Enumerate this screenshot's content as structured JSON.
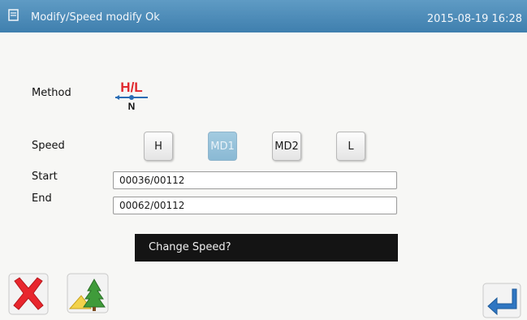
{
  "header": {
    "title": "Modify/Speed modify  Ok",
    "datetime": "2015-08-19 16:28"
  },
  "method": {
    "label": "Method",
    "icon_top_text": "H/L",
    "icon_bottom_text": "N"
  },
  "speed": {
    "label": "Speed",
    "options": [
      "H",
      "MD1",
      "MD2",
      "L"
    ],
    "selected": "MD1"
  },
  "start": {
    "label": "Start",
    "value": "00036/00112"
  },
  "end": {
    "label": "End",
    "value": "00062/00112"
  },
  "message": "Change Speed?",
  "icons": {
    "cancel": "close-icon",
    "pattern": "tree-pattern-icon",
    "enter": "enter-icon"
  },
  "colors": {
    "titlebar": "#4f8dba",
    "active_button": "#97c2da",
    "cancel_red": "#e8262d",
    "enter_blue": "#2f76c2"
  }
}
